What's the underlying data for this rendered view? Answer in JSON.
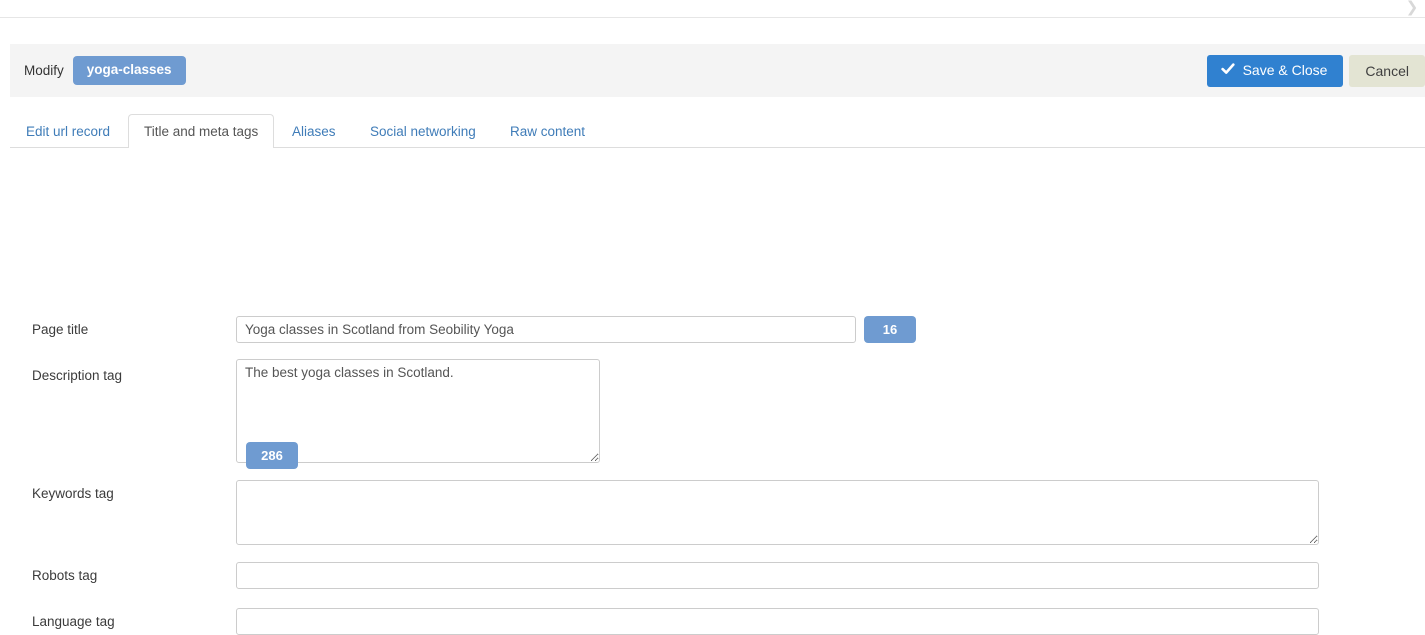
{
  "topbar": {
    "chevron_icon": "chevron-right-icon",
    "chevron_glyph": "❯"
  },
  "toolbar": {
    "modify_label": "Modify",
    "record_name": "yoga-classes",
    "save_label": "Save & Close",
    "save_icon": "check-icon",
    "cancel_label": "Cancel",
    "save_color": "#3081d0",
    "cancel_color": "#e3e4d3",
    "badge_color": "#6f9bd1",
    "background_color": "#f4f4f4"
  },
  "tabs": [
    {
      "label": "Edit url record",
      "active": false
    },
    {
      "label": "Title and meta tags",
      "active": true
    },
    {
      "label": "Aliases",
      "active": false
    },
    {
      "label": "Social networking",
      "active": false
    },
    {
      "label": "Raw content",
      "active": false
    }
  ],
  "form": {
    "page_title": {
      "label": "Page title",
      "value": "Yoga classes in Scotland from Seobility Yoga",
      "placeholder": "",
      "counter": "16"
    },
    "description_tag": {
      "label": "Description tag",
      "value": "The best yoga classes in Scotland.",
      "placeholder": "",
      "counter": "286"
    },
    "keywords_tag": {
      "label": "Keywords tag",
      "value": "",
      "placeholder": ""
    },
    "robots_tag": {
      "label": "Robots tag",
      "value": "",
      "placeholder": ""
    },
    "language_tag": {
      "label": "Language tag",
      "value": "",
      "placeholder": ""
    }
  }
}
